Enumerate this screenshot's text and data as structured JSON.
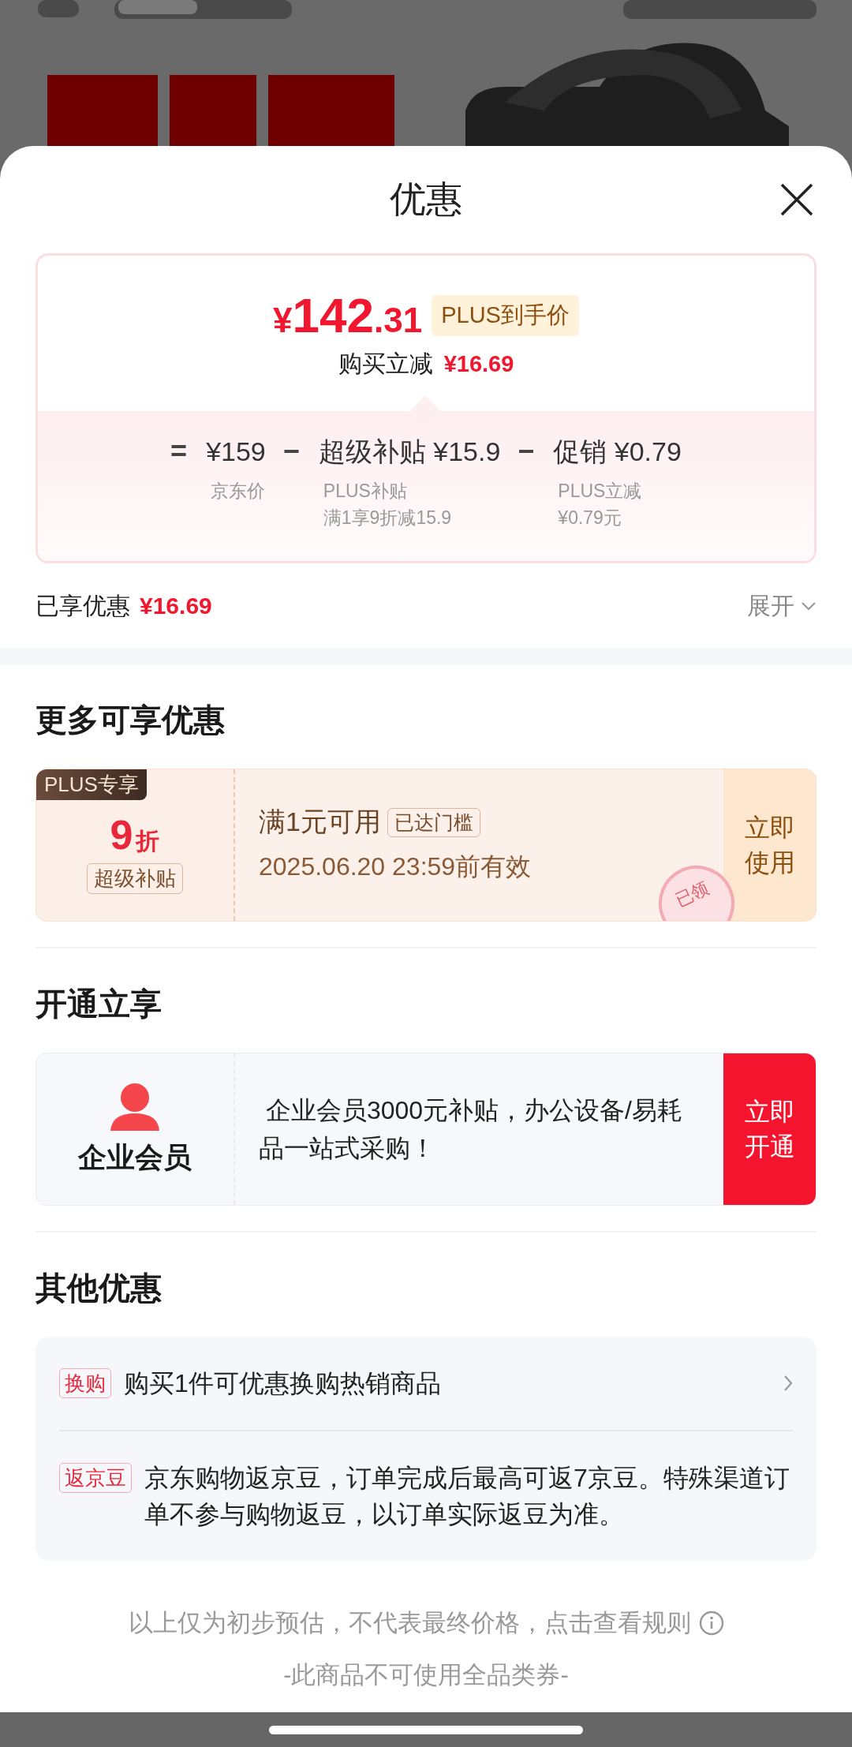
{
  "sheet": {
    "title": "优惠"
  },
  "price_card": {
    "currency": "¥",
    "price_int": "142",
    "price_dec": ".31",
    "badge": "PLUS到手价",
    "instant_label": "购买立减",
    "instant_amount": "¥16.69",
    "breakdown": [
      {
        "op": "=",
        "item": "¥159",
        "notes": [
          "京东价"
        ]
      },
      {
        "op": "−",
        "item": "超级补贴 ¥15.9",
        "notes": [
          "PLUS补贴",
          "满1享9折减15.9"
        ]
      },
      {
        "op": "−",
        "item": "促销 ¥0.79",
        "notes": [
          "PLUS立减",
          "¥0.79元"
        ]
      }
    ]
  },
  "enjoyed": {
    "label": "已享优惠",
    "amount": "¥16.69",
    "expand": "展开"
  },
  "more": {
    "heading": "更多可享优惠",
    "coupon": {
      "tag": "PLUS专享",
      "discount": "9",
      "unit": "折",
      "type": "超级补贴",
      "condition": "满1元可用",
      "threshold": "已达门槛",
      "validity": "2025.06.20 23:59前有效",
      "stamp": "已领",
      "action": "立即使用"
    }
  },
  "membership": {
    "heading": "开通立享",
    "name": "企业会员",
    "description": " 企业会员3000元补贴，办公设备/易耗品一站式采购！",
    "action": "立即开通"
  },
  "other": {
    "heading": "其他优惠",
    "items": [
      {
        "tag": "换购",
        "text": "购买1件可优惠换购热销商品",
        "has_arrow": true
      },
      {
        "tag": "返京豆",
        "text": "京东购物返京豆，订单完成后最高可返7京豆。特殊渠道订单不参与购物返豆，以订单实际返豆为准。",
        "has_arrow": false
      }
    ]
  },
  "footer": {
    "notice": "以上仅为初步预估，不代表最终价格，点击查看规则",
    "note": "-此商品不可使用全品类券-"
  }
}
